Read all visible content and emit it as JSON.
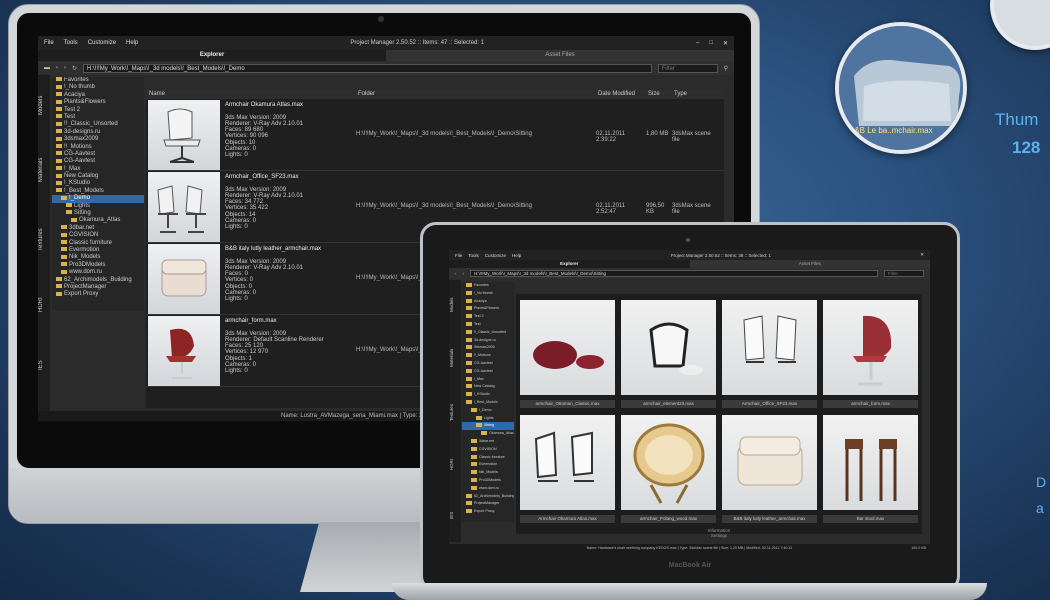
{
  "desktop_app": {
    "menu": [
      "File",
      "Tools",
      "Customize",
      "Help"
    ],
    "title": "Project Manager 2.50.52 :: Items: 47 :: Selected: 1",
    "tabs": [
      "Explorer",
      "Asset Files"
    ],
    "path": "H:\\!!!My_Work\\!_Maps\\!_3d models\\!_Best_Models\\!_Demo",
    "filter_placeholder": "Filter",
    "side_tabs": [
      "Models",
      "Materials",
      "Textures",
      "HDRI",
      "IES"
    ],
    "tree": [
      "Favorites",
      "!_No thumb",
      "Acaciya",
      "Plants&Flowers",
      "Test 2",
      "Test",
      "!!_Classic_Unsorted",
      "3d-designs.ru",
      "3dsmax2009",
      "!!_Motions",
      "CG-Aavtest",
      "CG-Aavtest",
      "!_Max",
      "New Catalog",
      "!_KStudio",
      "!_Best_Models",
      "!_Demo",
      "Lights",
      "Sitting",
      "Okamura_Atlas",
      "3dbar.net",
      "CGVISION",
      "Classic furniture",
      "Evermotion",
      "Nik_Models",
      "Pro3DModels",
      "www.dom.ru",
      "62_Archimodels_Building",
      "ProjectManager",
      "Export Proxy"
    ],
    "columns": [
      "Name",
      "Folder",
      "Date Modified",
      "Size",
      "Type"
    ],
    "rows": [
      {
        "name": "Armchair Okamura Atlas.max",
        "meta": "3ds Max Version: 2009\nRenderer: V-Ray Adv 2.10.01\nFaces: 89 680\nVertices: 90 096\nObjects: 10\nCameras: 0\nLights: 0",
        "folder": "H:\\!!!My_Work\\!_Maps\\!_3d models\\!_Best_Models\\!_Demo\\Sitting",
        "date": "02.11.2011 2:39:22",
        "size": "1,80 MB",
        "type": "3dsMax scene file"
      },
      {
        "name": "Armchair_Office_SF23.max",
        "meta": "3ds Max Version: 2009\nRenderer: V-Ray Adv 2.10.01\nFaces: 34 772\nVertices: 35 422\nObjects: 14\nCameras: 0\nLights: 0",
        "folder": "H:\\!!!My_Work\\!_Maps\\!_3d models\\!_Best_Models\\!_Demo\\Sitting",
        "date": "02.11.2011 2:52:47",
        "size": "996,50 KB",
        "type": "3dsMax scene file"
      },
      {
        "name": "B&B italy lutly leather_armchair.max",
        "meta": "3ds Max Version: 2009\nRenderer: V-Ray Adv 2.10.01\nFaces: 0\nVertices: 0\nObjects: 0\nCameras: 0\nLights: 0",
        "folder": "H:\\!!!My_Work\\!_Maps\\!_3d models\\!_Best_Models\\!_Demo\\Sitting",
        "date": "",
        "size": "",
        "type": ""
      },
      {
        "name": "armchair_form.max",
        "meta": "3ds Max Version: 2009\nRenderer: Default Scanline Renderer\nFaces: 25 120\nVertices: 12 970\nObjects: 1\nCameras: 0\nLights: 0",
        "folder": "H:\\!!!My_Work\\!_Maps\\!_3d models\\!_Best_Models\\!_Demo\\Sitting",
        "date": "",
        "size": "",
        "type": ""
      }
    ],
    "status": "Name: Lustra_AVMazega_seria_Miami.max | Type: 3dsMax scene file | Size: S"
  },
  "laptop_app": {
    "menu": [
      "File",
      "Tools",
      "Customize",
      "Help"
    ],
    "title": "Project Manager 2.50.52 :: Items: 38 :: Selected: 1",
    "tabs": [
      "Explorer",
      "Asset Files"
    ],
    "path": "H:\\!!!My_Work\\!_Maps\\!_3d models\\!_Best_Models\\!_Demo\\Sitting",
    "filter_placeholder": "Filter",
    "side_tabs": [
      "Models",
      "Materials",
      "Textures",
      "HDRI",
      "IES"
    ],
    "tree": [
      "Favorites",
      "!_No thumb",
      "Acaciya",
      "Plants&Flowers",
      "Test 2",
      "Test",
      "!!_Classic_Unsorted",
      "3d-designs.ru",
      "3dsmax2009",
      "!!_Motions",
      "CG-Aavtest",
      "CG-Aavtest",
      "!_Max",
      "New Catalog",
      "!_KStudio",
      "!_Best_Models",
      "!_Demo",
      "Lights",
      "Sitting",
      "Okamura_Atlas",
      "3dbar.net",
      "CGVISION",
      "Classic furniture",
      "Evermotion",
      "Nik_Models",
      "Pro3DModels",
      "www.dom.ru",
      "62_Archimodels_Building",
      "ProjectManager",
      "Export Proxy"
    ],
    "thumbs": [
      "armchair_Ottoman_Classic.max",
      "armchair_element23.max",
      "Armchair_Office_SF23.max",
      "armchair_form.max",
      "Armchair Okamura Atlas.max",
      "armchair_Polang_wood.max",
      "B&B italy lutly leather_armchair.max",
      "Bar stool.max"
    ],
    "bottom": [
      "Information",
      "Settings"
    ],
    "status": "Name: Hardware's chair seething company KEDOS.max | Type: 3dsMax scene file | Size: 1,20 MB | Modified: 02.11.2011 7:40:12",
    "zoom": "105.0 KB"
  },
  "laptop_brand": "MacBook Air",
  "promo": {
    "text_1": "Thum",
    "text_2": "128",
    "thumb_caption": "B&B Le ba..mchair.max",
    "text_3": "D",
    "text_4": "a"
  },
  "colors": {
    "accent": "#2e6aa8",
    "promo_text": "#5cb2ef"
  }
}
